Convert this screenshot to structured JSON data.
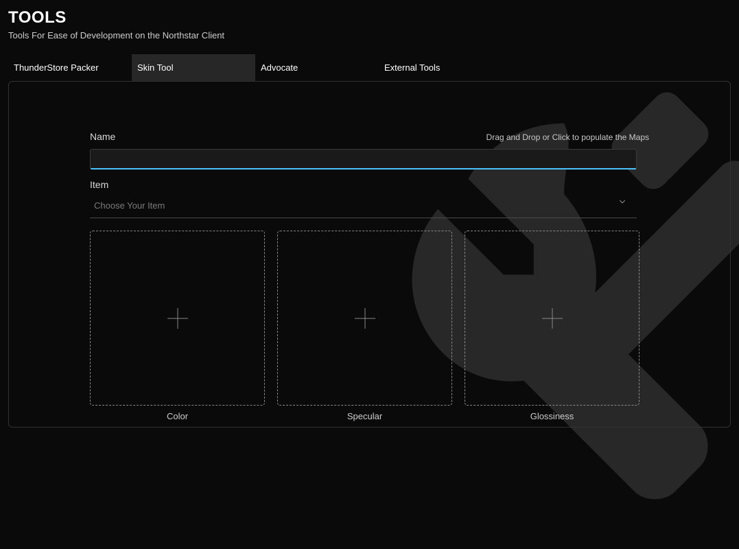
{
  "header": {
    "title": "TOOLS",
    "subtitle": "Tools For Ease of Development on the Northstar Client"
  },
  "tabs": [
    {
      "label": "ThunderStore Packer",
      "active": false
    },
    {
      "label": "Skin Tool",
      "active": true
    },
    {
      "label": "Advocate",
      "active": false
    },
    {
      "label": "External Tools",
      "active": false
    }
  ],
  "form": {
    "name_label": "Name",
    "name_value": "",
    "hint": "Drag and Drop or Click to populate the Maps",
    "item_label": "Item",
    "item_placeholder": "Choose Your Item"
  },
  "maps": [
    {
      "label": "Color"
    },
    {
      "label": "Specular"
    },
    {
      "label": "Glossiness"
    }
  ]
}
